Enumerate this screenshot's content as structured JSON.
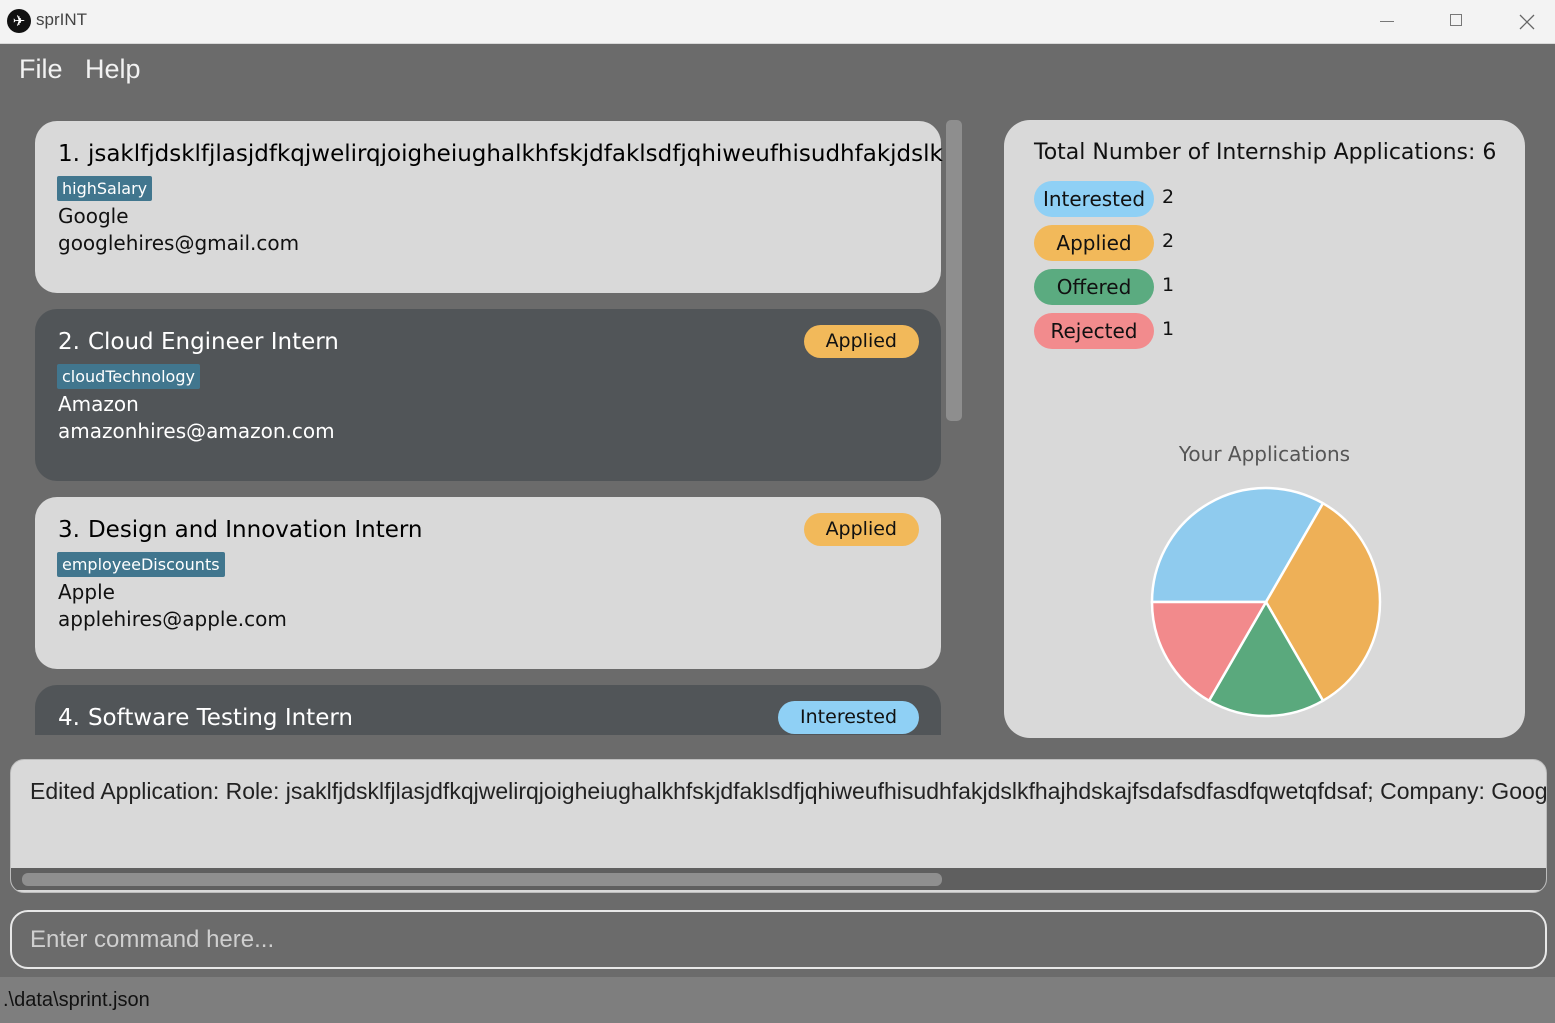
{
  "window": {
    "title": "sprINT",
    "icons": {
      "minimize": "minimize-icon",
      "maximize": "maximize-icon",
      "close": "close-icon"
    }
  },
  "menu": {
    "file": "File",
    "help": "Help"
  },
  "applications": [
    {
      "index": "1.",
      "role": "jsaklfjdsklfjlasjdfkqjwelirqjoigheiughalkhfskjdfaklsdfjqhiweufhisudhfakjdslkfhajhdskajfsdafsdfasdfqwetqfdsaf",
      "tag": "highSalary",
      "company": "Google",
      "email": "googlehires@gmail.com",
      "status": ""
    },
    {
      "index": "2.",
      "role": "Cloud Engineer Intern",
      "tag": "cloudTechnology",
      "company": "Amazon",
      "email": "amazonhires@amazon.com",
      "status": "Applied"
    },
    {
      "index": "3.",
      "role": "Design and Innovation Intern",
      "tag": "employeeDiscounts",
      "company": "Apple",
      "email": "applehires@apple.com",
      "status": "Applied"
    },
    {
      "index": "4.",
      "role": "Software Testing Intern",
      "tag": "",
      "company": "",
      "email": "",
      "status": "Interested"
    }
  ],
  "stats": {
    "title": "Total Number of Internship Applications: 6",
    "items": [
      {
        "label": "Interested",
        "count": "2",
        "color": "#8fd0f5"
      },
      {
        "label": "Applied",
        "count": "2",
        "color": "#f2b95a"
      },
      {
        "label": "Offered",
        "count": "1",
        "color": "#5bab80"
      },
      {
        "label": "Rejected",
        "count": "1",
        "color": "#f28b8d"
      }
    ]
  },
  "chart_data": {
    "type": "pie",
    "title": "Your Applications",
    "categories": [
      "Interested",
      "Applied",
      "Offered",
      "Rejected"
    ],
    "values": [
      2,
      2,
      1,
      1
    ],
    "colors": [
      "#8fcbee",
      "#eeb057",
      "#5aa97d",
      "#f28a8c"
    ],
    "legend": "none"
  },
  "result": {
    "text": "Edited Application: Role: jsaklfjdsklfjlasjdfkqjwelirqjoigheiughalkhfskjdfaklsdfjqhiweufhisudhfakjdslkfhajhdskajfsdafsdfasdfqwetqfdsaf; Company: Google"
  },
  "command": {
    "placeholder": "Enter command here..."
  },
  "status_bar": {
    "path": ".\\data\\sprint.json"
  }
}
